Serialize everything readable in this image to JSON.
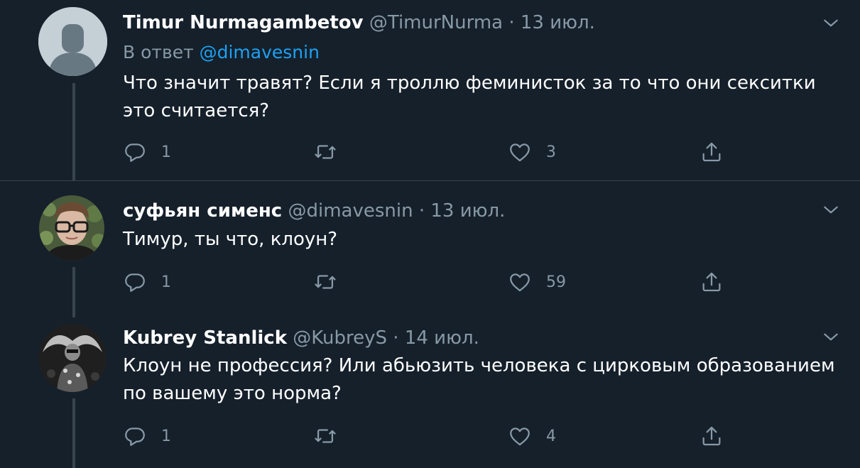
{
  "tweets": [
    {
      "name": "Timur Nurmagambetov",
      "handle": "@TimurNurma",
      "separator": "·",
      "date": "13 июл.",
      "reply_prefix": "В ответ",
      "reply_mention": "@dimavesnin",
      "text": "Что значит травят? Если я троллю феминисток за то что они секситки это считается?",
      "replies": "1",
      "likes": "3",
      "avatar": "default-avatar"
    },
    {
      "name": "суфьян сименс",
      "handle": "@dimavesnin",
      "separator": "·",
      "date": "13 июл.",
      "text": "Тимур, ты что, клоун?",
      "replies": "1",
      "likes": "59",
      "avatar": "photo-avatar"
    },
    {
      "name": "Kubrey Stanlick",
      "handle": "@KubreyS",
      "separator": "·",
      "date": "14 июл.",
      "text": "Клоун не профессия? Или абьюзить человека с цирковым образованием по вашему это норма?",
      "replies": "1",
      "likes": "4",
      "avatar": "photo-avatar-bw"
    }
  ],
  "colors": {
    "background": "#15202b",
    "secondary_text": "#8899a6",
    "link": "#1da1f2",
    "divider": "#38444d"
  },
  "icons": {
    "reply": "reply-icon",
    "retweet": "retweet-icon",
    "like": "heart-icon",
    "share": "share-icon",
    "menu": "chevron-down-icon"
  }
}
